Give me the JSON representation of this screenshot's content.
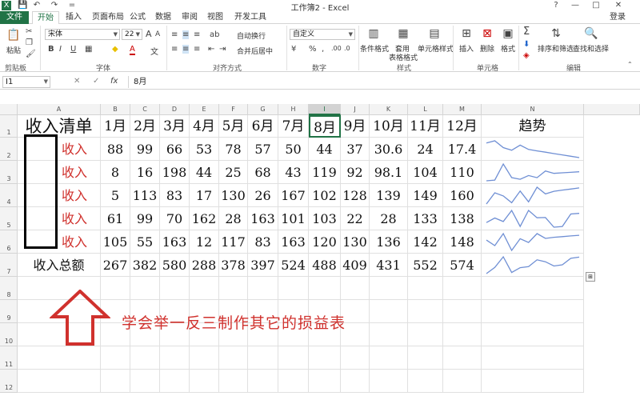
{
  "window": {
    "title": "工作簿2 - Excel",
    "help": "?",
    "minimize": "—",
    "restore": "□",
    "close": "✕",
    "login": "登录"
  },
  "quick_access": {
    "app_icon": "X",
    "save": "💾",
    "undo": "↶",
    "redo": "↷",
    "customize": "="
  },
  "menu": {
    "file": "文件",
    "tabs": [
      "开始",
      "插入",
      "页面布局",
      "公式",
      "数据",
      "审阅",
      "视图",
      "开发工具"
    ],
    "active_tab": "开始"
  },
  "ribbon": {
    "clipboard": {
      "paste": "粘贴",
      "group": "剪贴板"
    },
    "font": {
      "family": "宋体",
      "size": "22",
      "bold": "B",
      "italic": "I",
      "underline": "U",
      "grow": "A",
      "shrink": "A",
      "fill": "◆",
      "color": "A",
      "group": "字体",
      "wen": "文"
    },
    "align": {
      "wrap": "自动换行",
      "merge": "合并后居中",
      "group": "对齐方式"
    },
    "number": {
      "format": "自定义",
      "percent": "%",
      "comma": ",",
      "group": "数字"
    },
    "styles": {
      "cond": "条件格式",
      "table1": "套用",
      "table2": "表格格式",
      "cell": "单元格样式",
      "group": "样式"
    },
    "cells": {
      "insert": "插入",
      "delete": "删除",
      "format": "格式",
      "group": "单元格"
    },
    "editing": {
      "sum": "Σ",
      "sort": "排序和筛选",
      "find": "查找和选择",
      "group": "编辑"
    }
  },
  "formula_bar": {
    "name_box": "I1",
    "cancel": "✕",
    "enter": "✓",
    "fx": "fx",
    "value": "8月"
  },
  "columns": [
    "A",
    "B",
    "C",
    "D",
    "E",
    "F",
    "G",
    "H",
    "I",
    "J",
    "K",
    "L",
    "M",
    "N"
  ],
  "rows": [
    "1",
    "2",
    "3",
    "4",
    "5",
    "6",
    "7",
    "8",
    "9",
    "10",
    "11",
    "12"
  ],
  "sheet": {
    "header_label": "收入清单",
    "months": [
      "1月",
      "2月",
      "3月",
      "4月",
      "5月",
      "6月",
      "7月",
      "8月",
      "9月",
      "10月",
      "11月",
      "12月"
    ],
    "trend_label": "趋势",
    "row_label": "收入",
    "data": [
      [
        "88",
        "99",
        "66",
        "53",
        "78",
        "57",
        "50",
        "44",
        "37",
        "30.6",
        "24",
        "17.4"
      ],
      [
        "8",
        "16",
        "198",
        "44",
        "25",
        "68",
        "43",
        "119",
        "92",
        "98.1",
        "104",
        "110"
      ],
      [
        "5",
        "113",
        "83",
        "17",
        "130",
        "26",
        "167",
        "102",
        "128",
        "139",
        "149",
        "160"
      ],
      [
        "61",
        "99",
        "70",
        "162",
        "28",
        "163",
        "101",
        "103",
        "22",
        "28",
        "133",
        "138"
      ],
      [
        "105",
        "55",
        "163",
        "12",
        "117",
        "83",
        "163",
        "120",
        "130",
        "136",
        "142",
        "148"
      ]
    ],
    "total_label": "收入总额",
    "totals": [
      "267",
      "382",
      "580",
      "288",
      "378",
      "397",
      "524",
      "488",
      "409",
      "431",
      "552",
      "574"
    ]
  },
  "sparkline_color": "#6f8fd4",
  "annotation": {
    "text": "学会举一反三制作其它的损益表",
    "color": "#d0312d",
    "arrow": "up-arrow"
  },
  "colors": {
    "excel_green": "#217346",
    "red_text": "#d0312d"
  }
}
